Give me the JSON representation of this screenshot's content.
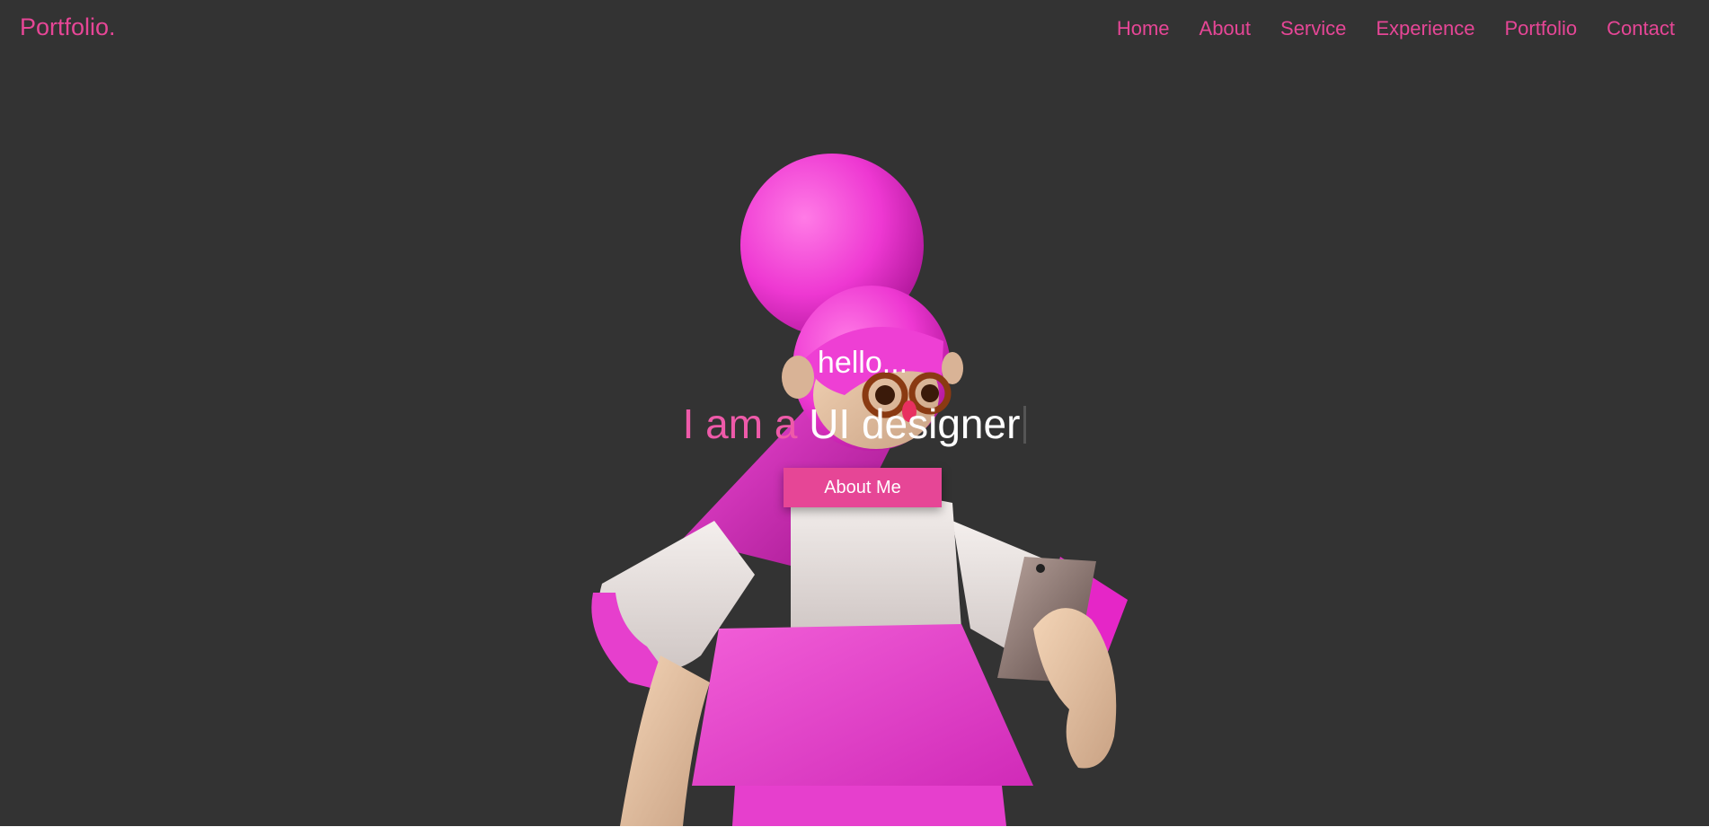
{
  "logo": "Portfolio.",
  "nav": {
    "items": [
      {
        "label": "Home"
      },
      {
        "label": "About"
      },
      {
        "label": "Service"
      },
      {
        "label": "Experience"
      },
      {
        "label": "Portfolio"
      },
      {
        "label": "Contact"
      }
    ]
  },
  "hero": {
    "greeting": "hello...",
    "headline_prefix": "I am a",
    "headline_role": "UI designer",
    "button_label": "About Me"
  },
  "colors": {
    "accent": "#e64696",
    "background": "#333333",
    "text": "#ffffff"
  },
  "icons": [
    "pink-3d-character-illustration"
  ]
}
